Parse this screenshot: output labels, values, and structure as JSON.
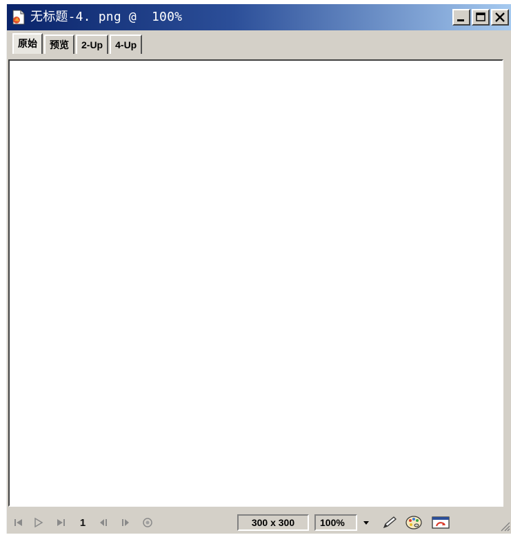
{
  "window": {
    "title": "无标题-4. png @  100%"
  },
  "tabs": [
    {
      "label": "原始",
      "active": true
    },
    {
      "label": "预览",
      "active": false
    },
    {
      "label": "2-Up",
      "active": false
    },
    {
      "label": "4-Up",
      "active": false
    }
  ],
  "statusbar": {
    "frame_number": "1",
    "image_size": "300 x 300",
    "zoom": "100%"
  },
  "colors": {
    "titlebar_start": "#0a246a",
    "titlebar_end": "#a6caf0",
    "chrome": "#d4d0c8",
    "canvas": "#ffffff"
  },
  "icons": {
    "app": "document-icon",
    "minimize": "minimize-icon",
    "maximize": "maximize-icon",
    "close": "close-icon",
    "first_frame": "first-frame-icon",
    "play": "play-icon",
    "last_frame": "last-frame-icon",
    "prev_frame": "previous-frame-icon",
    "next_frame": "next-frame-icon",
    "stop": "stop-icon",
    "zoom_dropdown": "chevron-down-icon",
    "pencil": "pencil-icon",
    "palette": "palette-icon",
    "preview": "preview-in-browser-icon"
  }
}
